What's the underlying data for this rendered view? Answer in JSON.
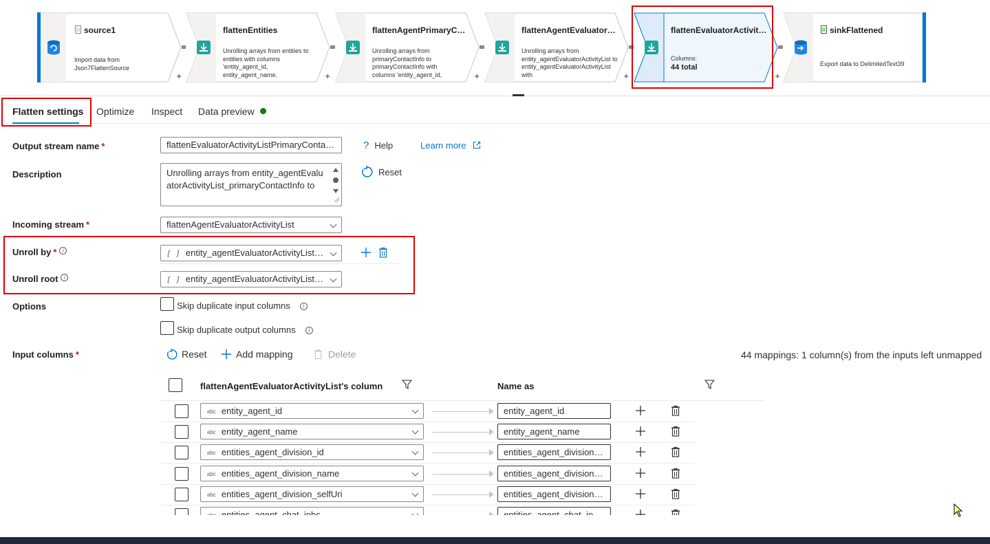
{
  "pipeline": {
    "nodes": [
      {
        "title": "source1",
        "desc": "Import data from Json7FlattenSource"
      },
      {
        "title": "flattenEntities",
        "desc": "Unrolling arrays from entities to entities with columns 'entity_agent_id, entity_agent_name, entities_agent_division_id"
      },
      {
        "title": "flattenAgentPrimaryCo...",
        "desc": "Unrolling arrays from primaryContactInfo to primaryContactInfo with columns 'entity_agent_id, entity_agent_name"
      },
      {
        "title": "flattenAgentEvaluatorA...",
        "desc": "Unrolling arrays from entity_agentEvaluatorActivityList to entity_agentEvaluatorActivityList with"
      },
      {
        "title": "flattenEvaluatorActivity...",
        "columns_label": "Columns:",
        "columns_value": "44 total"
      },
      {
        "title": "sinkFlattened",
        "desc": "Export data to DelimitedText39"
      }
    ],
    "plus": "+"
  },
  "tabs": [
    "Flatten settings",
    "Optimize",
    "Inspect",
    "Data preview"
  ],
  "form": {
    "output_stream_label": "Output stream name",
    "output_stream_value": "flattenEvaluatorActivityListPrimaryContac...",
    "help": "Help",
    "learn_more": "Learn more",
    "description_label": "Description",
    "description_value": "Unrolling arrays from entity_agentEvaluatorActivityList_primaryContactInfo to",
    "reset": "Reset",
    "incoming_label": "Incoming stream",
    "incoming_value": "flattenAgentEvaluatorActivityList",
    "unroll_by_label": "Unroll by",
    "unroll_by_value": "entity_agentEvaluatorActivityList_...",
    "unroll_root_label": "Unroll root",
    "unroll_root_value": "entity_agentEvaluatorActivityList_...",
    "bracket": "[ ]",
    "options_label": "Options",
    "skip_input": "Skip duplicate input columns",
    "skip_output": "Skip duplicate output columns",
    "input_columns_label": "Input columns",
    "required_mark": "*",
    "info": "i"
  },
  "mappings": {
    "reset": "Reset",
    "add": "Add mapping",
    "delete": "Delete",
    "summary": "44 mappings: 1 column(s) from the inputs left unmapped",
    "col_source_header": "flattenAgentEvaluatorActivityList's column",
    "col_target_header": "Name as",
    "type_tag": "abc",
    "rows": [
      {
        "source": "entity_agent_id",
        "target": "entity_agent_id"
      },
      {
        "source": "entity_agent_name",
        "target": "entity_agent_name"
      },
      {
        "source": "entities_agent_division_id",
        "target": "entities_agent_division_id"
      },
      {
        "source": "entities_agent_division_name",
        "target": "entities_agent_division_..."
      },
      {
        "source": "entities_agent_division_selfUri",
        "target": "entities_agent_division_..."
      },
      {
        "source": "entities_agent_chat_jobs",
        "target": "entities_agent_chat_job..."
      }
    ]
  },
  "colors": {
    "accent": "#0078d4",
    "highlight": "#e00000",
    "status_ok": "#107c10"
  }
}
